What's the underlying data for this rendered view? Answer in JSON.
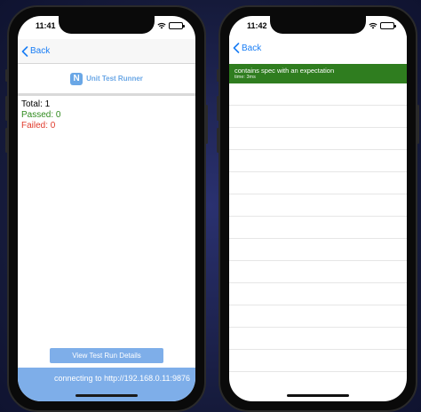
{
  "left_phone": {
    "status": {
      "time": "11:41"
    },
    "nav": {
      "back_label": "Back"
    },
    "header": {
      "logo_letter": "N",
      "title": "Unit Test Runner"
    },
    "summary": {
      "total": "Total: 1",
      "passed": "Passed: 0",
      "failed": "Failed: 0"
    },
    "details_button": "View Test Run Details",
    "footer": "connecting to http://192.168.0.11:9876"
  },
  "right_phone": {
    "status": {
      "time": "11:42"
    },
    "nav": {
      "back_label": "Back"
    },
    "results": [
      {
        "name": "contains spec with an expectation",
        "time": "time: 3ms"
      }
    ]
  },
  "colors": {
    "accent": "#1a7ef5",
    "button_blue": "#7eaee9",
    "pass_green": "#2f7d1f",
    "fail_red": "#e03a2b"
  }
}
